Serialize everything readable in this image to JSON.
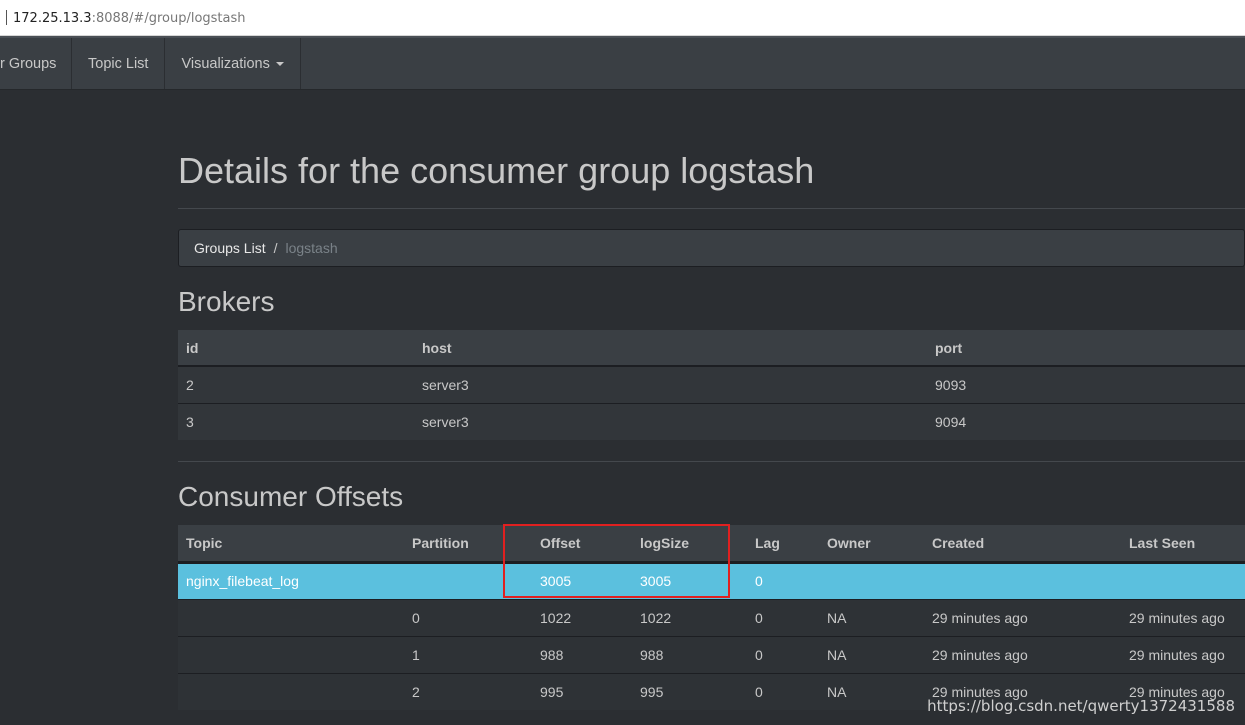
{
  "urlbar": {
    "host": "172.25.13.3",
    "rest": ":8088/#/group/logstash"
  },
  "nav": {
    "items": [
      {
        "label": "r Groups"
      },
      {
        "label": "Topic List"
      },
      {
        "label": "Visualizations"
      }
    ]
  },
  "page": {
    "title": "Details for the consumer group logstash",
    "breadcrumb": {
      "link": "Groups List",
      "separator": "/",
      "active": "logstash"
    }
  },
  "brokers": {
    "title": "Brokers",
    "columns": [
      "id",
      "host",
      "port"
    ],
    "rows": [
      [
        "2",
        "server3",
        "9093"
      ],
      [
        "3",
        "server3",
        "9094"
      ]
    ]
  },
  "offsets": {
    "title": "Consumer Offsets",
    "columns": [
      "Topic",
      "Partition",
      "Offset",
      "logSize",
      "Lag",
      "Owner",
      "Created",
      "Last Seen"
    ],
    "topic_row": [
      "nginx_filebeat_log",
      "",
      "3005",
      "3005",
      "0",
      "",
      "",
      ""
    ],
    "rows": [
      [
        "",
        "0",
        "1022",
        "1022",
        "0",
        "NA",
        "29 minutes ago",
        "29 minutes ago"
      ],
      [
        "",
        "1",
        "988",
        "988",
        "0",
        "NA",
        "29 minutes ago",
        "29 minutes ago"
      ],
      [
        "",
        "2",
        "995",
        "995",
        "0",
        "NA",
        "29 minutes ago",
        "29 minutes ago"
      ]
    ]
  },
  "watermark": "https://blog.csdn.net/qwerty1372431588",
  "colors": {
    "background": "#2b2e32",
    "navbar": "#3a3f44",
    "topic_highlight": "#5bc0de",
    "annotation": "#e02020"
  }
}
